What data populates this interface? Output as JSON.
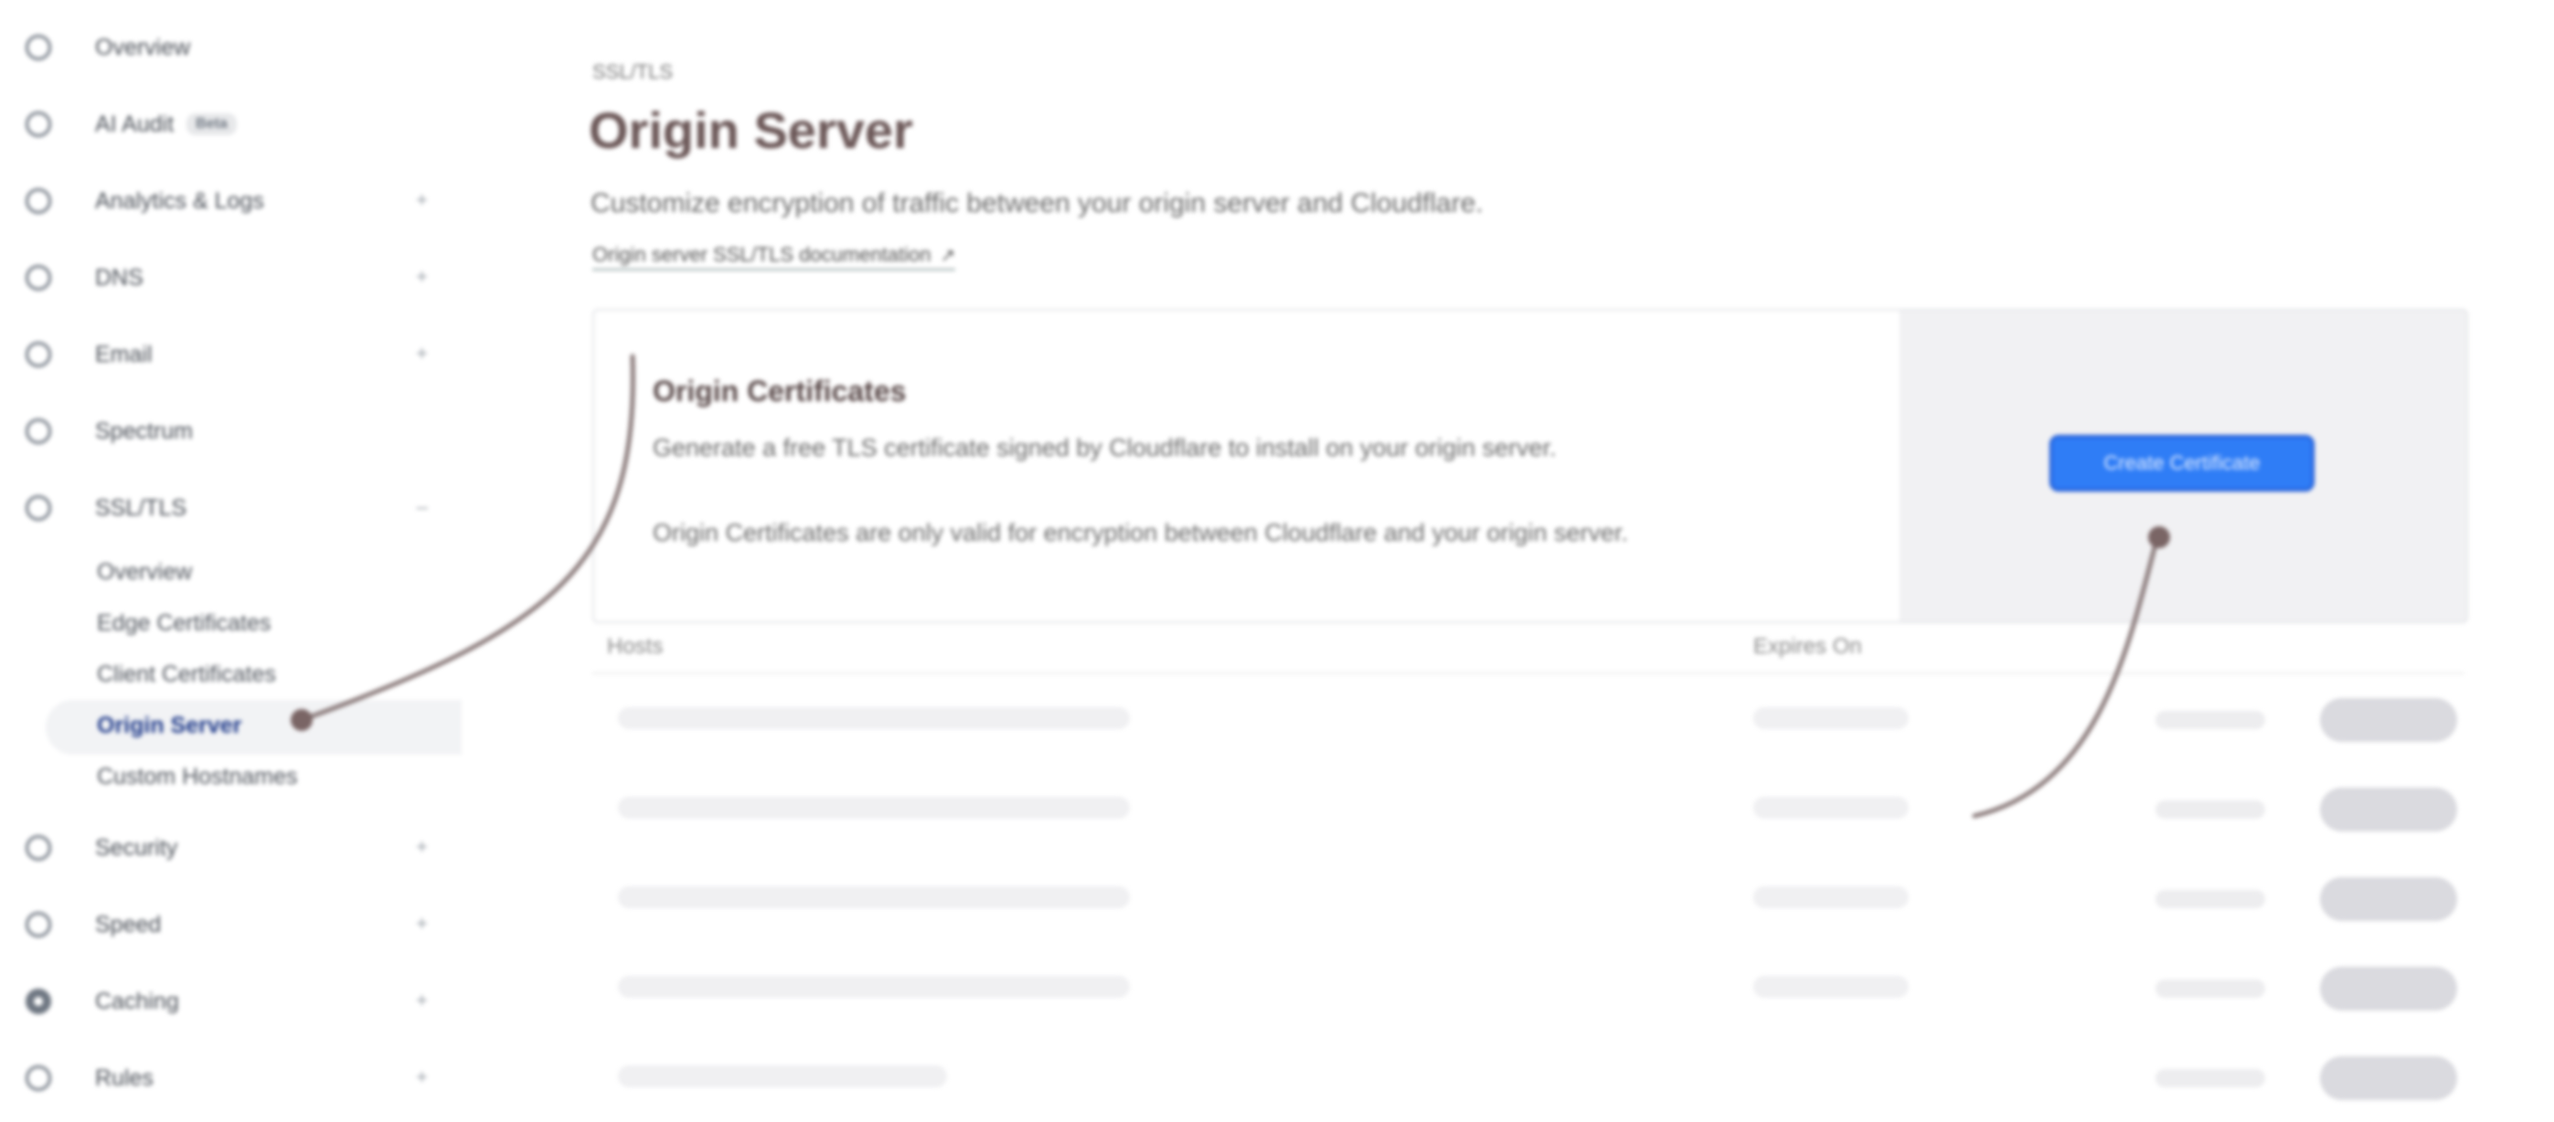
{
  "sidebar": {
    "items": [
      {
        "label": "Overview",
        "icon": "info-icon"
      },
      {
        "label": "AI Audit",
        "icon": "ai-icon",
        "badge": "Beta"
      },
      {
        "label": "Analytics & Logs",
        "icon": "chart-icon",
        "chevron": "+"
      },
      {
        "label": "DNS",
        "icon": "dns-icon",
        "chevron": "+"
      },
      {
        "label": "Email",
        "icon": "email-icon",
        "chevron": "+"
      },
      {
        "label": "Spectrum",
        "icon": "spectrum-icon"
      },
      {
        "label": "SSL/TLS",
        "icon": "lock-icon",
        "chevron": "–"
      },
      {
        "label": "Security",
        "icon": "shield-icon",
        "chevron": "+"
      },
      {
        "label": "Speed",
        "icon": "bolt-icon",
        "chevron": "+"
      },
      {
        "label": "Caching",
        "icon": "caching-icon",
        "chevron": "+"
      },
      {
        "label": "Rules",
        "icon": "rules-icon",
        "chevron": "+"
      }
    ],
    "ssl_sub": [
      {
        "label": "Overview"
      },
      {
        "label": "Edge Certificates"
      },
      {
        "label": "Client Certificates"
      },
      {
        "label": "Origin Server"
      },
      {
        "label": "Custom Hostnames"
      }
    ]
  },
  "main": {
    "breadcrumb": "SSL/TLS",
    "title": "Origin Server",
    "subtitle": "Customize encryption of traffic between your origin server and Cloudflare.",
    "doc_link": "Origin server SSL/TLS documentation",
    "card": {
      "title": "Origin Certificates",
      "description": "Generate a free TLS certificate signed by Cloudflare to install on your origin server.",
      "note": "Origin Certificates are only valid for encryption between Cloudflare and your origin server.",
      "button": "Create Certificate"
    },
    "table": {
      "columns": [
        "Hosts",
        "Expires On"
      ]
    }
  },
  "colors": {
    "accent": "#2f7df6",
    "annotation": "#8a7a7a"
  }
}
